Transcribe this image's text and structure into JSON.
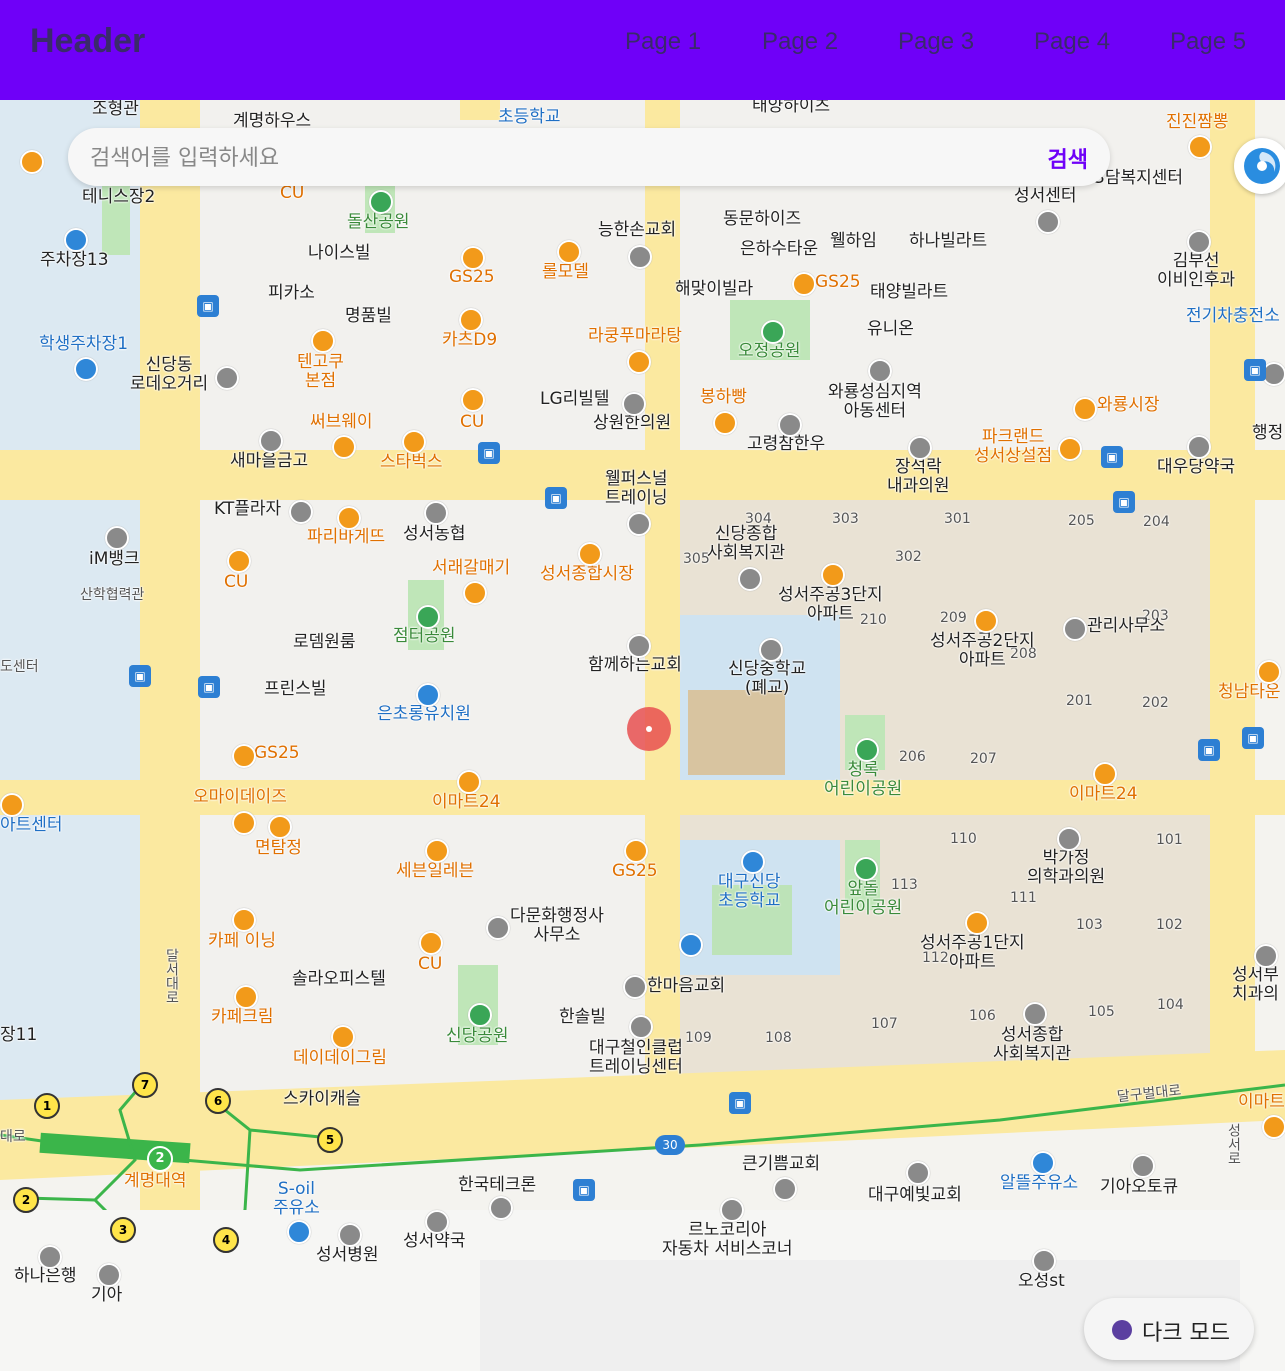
{
  "header": {
    "title": "Header",
    "nav": [
      "Page 1",
      "Page 2",
      "Page 3",
      "Page 4",
      "Page 5"
    ]
  },
  "search": {
    "placeholder": "검색어를 입력하세요",
    "button": "검색"
  },
  "dark_mode": {
    "label": "다크 모드"
  },
  "map_labels": {
    "jo_hyeong_gwan": "조형관",
    "gyemyeong_house": "계명하우스",
    "daegu_shindang_elem_top": "초등학교",
    "taeyang_heights": "태양하이츠",
    "jinjin_jjambbong": "진진짬뽕",
    "cu1": "CU",
    "tennis2": "테니스장2",
    "dolsan_park": "돌산공원",
    "nice_bill": "나이스빌",
    "neunghanson_church": "능한손교회",
    "dongmun_heights": "동문하이즈",
    "eunha_sutaun": "은하수타운",
    "wellhaim": "웰하임",
    "hana_villat": "하나빌라트",
    "seongseo_center": "성서센터",
    "damboksi_center": "3담복지센터",
    "parking13": "주차장13",
    "gs25_a": "GS25",
    "rollmodel": "롤모델",
    "haemaji_villa": "해맞이빌라",
    "gs25_b": "GS25",
    "taeyang_villat": "태양빌라트",
    "kimbuseon_ent": "김부선\n이비인후과",
    "ev_station": "전기차충전소",
    "picasso": "피카소",
    "myeongpum_bill": "명품빌",
    "cats_d9": "카츠D9",
    "lakungfu": "라쿵푸마라탕",
    "ojeong_park": "오정공원",
    "unions": "유니온",
    "student_parking1": "학생주차장1",
    "tengcook": "텐고쿠\n본점",
    "shindang_rodeo": "신당동\n로데오거리",
    "lg_billtel": "LG리빌텔",
    "bongha_bbang": "봉하빵",
    "waryong_office": "와룡성심지역\n아동센터",
    "waryong_market": "와룡시장",
    "subway": "써브웨이",
    "cu2": "CU",
    "sangwon_clinic": "상원한의원",
    "goryeong_hanwoo": "고령참한우",
    "parkland": "파크랜드\n성서상설점",
    "haengjeong": "행정",
    "saemaeul": "새마을금고",
    "starbucks": "스타벅스",
    "jangseokrak": "장석락\n내과의원",
    "daewoo_pharm": "대우당약국",
    "wellpers": "웰퍼스널\n트레이닝",
    "kt_plaza": "KT플라자",
    "paris_baguette": "파리바게뜨",
    "seongseo_nonghyup": "성서농협",
    "shindang_welfare": "신당종합\n사회복지관",
    "im_bank": "iM뱅크",
    "sanhak_gwan": "산학협력관",
    "seorae_galmaegi": "서래갈매기",
    "seongseo_market": "성서종합시장",
    "cu3": "CU",
    "seongseo_apt3": "성서주공3단지\n아파트",
    "management": "관리사무소",
    "rodem": "로뎀원룸",
    "jeomteo_park": "점터공원",
    "hamkke_church": "함께하는교회",
    "shindang_ms": "신당중학교\n(폐교)",
    "seongseo_apt2": "성서주공2단지\n아파트",
    "cheongnam": "청남타운",
    "do_center": "도센터",
    "prince_bill": "프린스빌",
    "eunchorong": "은초롱유치원",
    "gs25_c": "GS25",
    "cheongrok": "청록\n어린이공원",
    "emart24_a": "이마트24",
    "omy_daze": "오마이데이즈",
    "emart24_b": "이마트24",
    "art_center": "아트센터",
    "myeontamjeong": "면탐정",
    "seven_eleven": "세븐일레븐",
    "gs25_d": "GS25",
    "daegu_shindang_elem": "대구신당\n초등학교",
    "apdol_park": "앞돌\n어린이공원",
    "bakgajeong": "박가정\n의학과의원",
    "damun_office": "다문화행정사\n사무소",
    "cafe_ining": "카페 이닝",
    "cu4": "CU",
    "seongseo_apt1": "성서주공1단지\n아파트",
    "seongseo_dental": "성서부\n치과의",
    "solar_office": "솔라오피스텔",
    "hanmaeum_church": "한마음교회",
    "dalseo_daero": "달서대로",
    "cafe_krim": "카페크림",
    "shindang_park": "신당공원",
    "hansolbill": "한솔빌",
    "daydaygrim": "데이데이그림",
    "daegu_iron": "대구철인클럽\n트레이닝센터",
    "seongseo_welfare": "성서종합\n사회복지관",
    "parking11": "장11",
    "sky_castle": "스카이캐슬",
    "dalgubeol": "달구벌대로",
    "emart24_c": "이마트",
    "gyemyeong_station": "계명대역",
    "soil": "S-oil\n주유소",
    "hankook_techron": "한국테크론",
    "keunggippeum": "큰기쁨교회",
    "daegu_yebit": "대구예빛교회",
    "altteul": "알뜰주유소",
    "gia_autoq": "기아오토큐",
    "seongseo_hospital": "성서병원",
    "seongseo_pharm": "성서약국",
    "renault": "르노코리아\n자동차 서비스코너",
    "hana_bank": "하나은행",
    "kia": "기아",
    "oseong_st": "오성st",
    "route_30": "30",
    "seongseo_ro": "성서로",
    "daero_left": "대로"
  },
  "apt_numbers": {
    "a304": "304",
    "a303": "303",
    "a301": "301",
    "a305": "305",
    "a302": "302",
    "a205": "205",
    "a204": "204",
    "a210": "210",
    "a209": "209",
    "a208": "208",
    "a203": "203",
    "a201": "201",
    "a202": "202",
    "a206": "206",
    "a207": "207",
    "a110": "110",
    "a101": "101",
    "a113": "113",
    "a111": "111",
    "a103": "103",
    "a102": "102",
    "a112": "112",
    "a109": "109",
    "a108": "108",
    "a107": "107",
    "a106": "106",
    "a105": "105",
    "a104": "104"
  },
  "subway_exits": [
    "1",
    "7",
    "6",
    "5",
    "2",
    "3",
    "4"
  ],
  "station_line": "2"
}
